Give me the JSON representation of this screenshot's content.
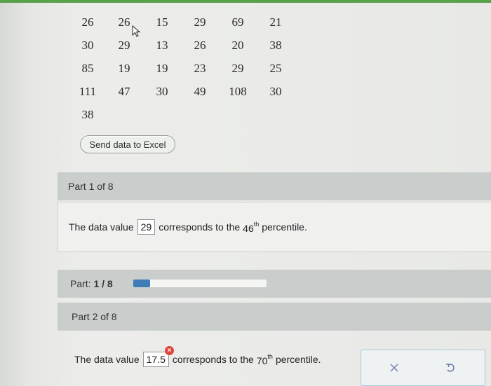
{
  "data_table": {
    "rows": [
      [
        "26",
        "26",
        "15",
        "29",
        "69",
        "21"
      ],
      [
        "30",
        "29",
        "13",
        "26",
        "20",
        "38"
      ],
      [
        "85",
        "19",
        "19",
        "23",
        "29",
        "25"
      ],
      [
        "111",
        "47",
        "30",
        "49",
        "108",
        "30"
      ],
      [
        "38"
      ]
    ]
  },
  "send_button": {
    "label": "Send data to Excel"
  },
  "part1": {
    "header": "Part 1 of 8",
    "prefix": "The data value",
    "answer": "29",
    "middle": "corresponds to the",
    "percentile": "46",
    "ordinal": "th",
    "suffix": "percentile."
  },
  "progress": {
    "label_prefix": "Part:",
    "label_value": "1 / 8",
    "fraction": 0.125,
    "fill_color": "#3f7cb8"
  },
  "part2": {
    "header": "Part 2 of 8",
    "prefix": "The data value",
    "answer": "17.5",
    "middle": "corresponds to the",
    "percentile": "70",
    "ordinal": "th",
    "suffix": "percentile.",
    "error_icon": "error-x-icon"
  },
  "actions": {
    "clear_icon": "close-icon",
    "undo_icon": "undo-icon"
  }
}
